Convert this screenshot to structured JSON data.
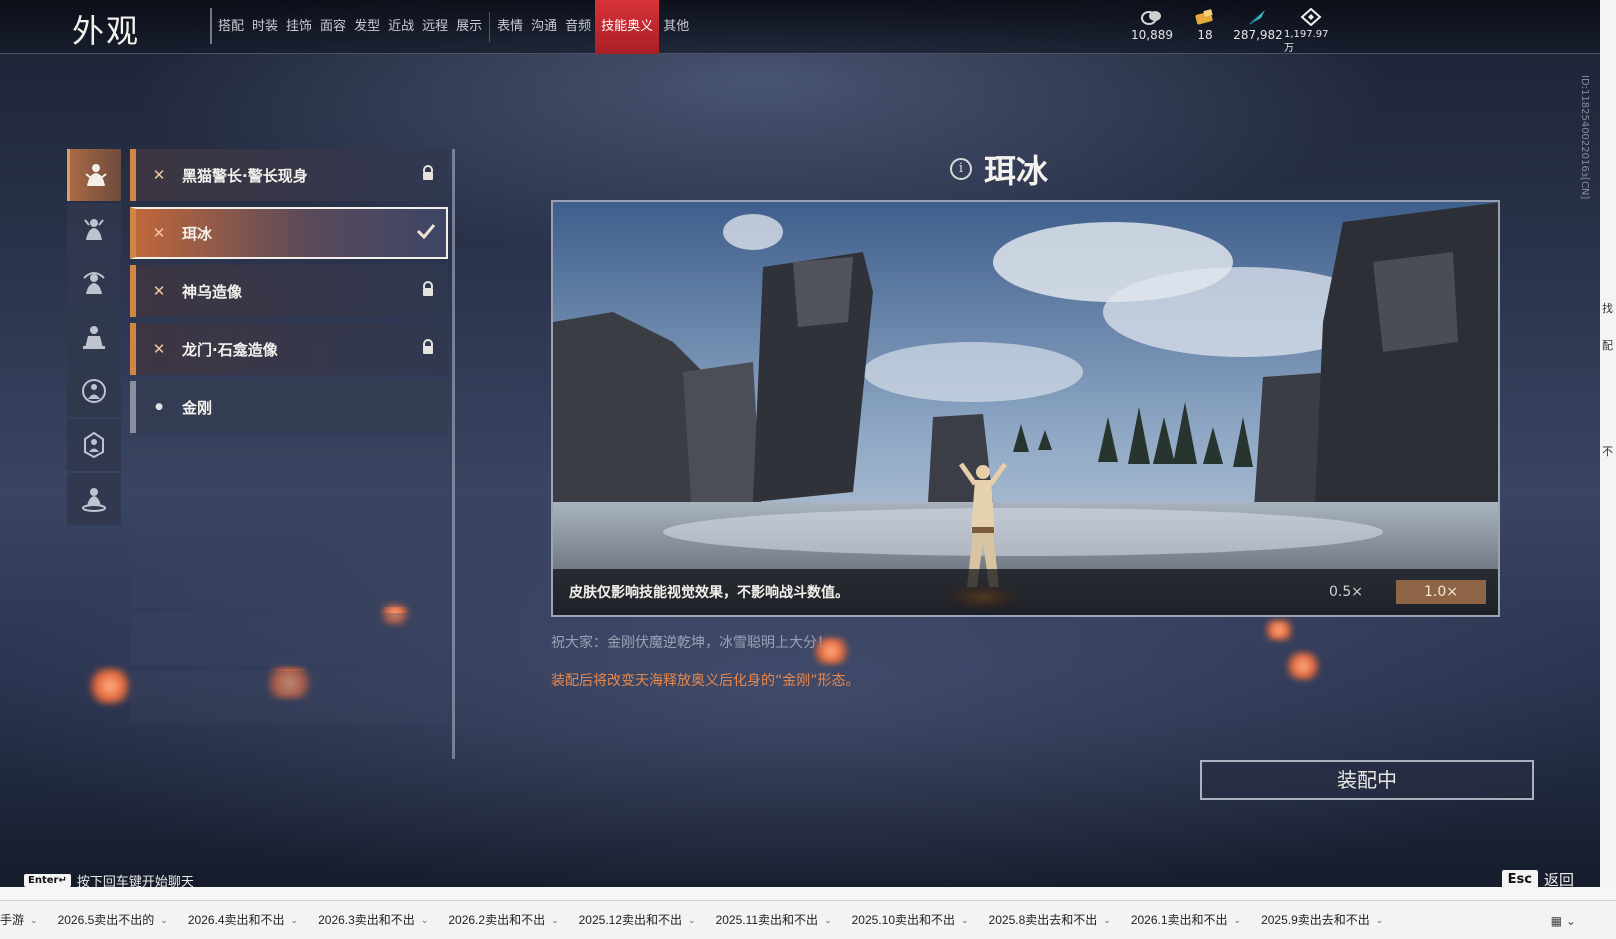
{
  "app": {
    "title": "外观"
  },
  "nav": {
    "tabs": [
      {
        "label": "搭配"
      },
      {
        "label": "时装"
      },
      {
        "label": "挂饰"
      },
      {
        "label": "面容"
      },
      {
        "label": "发型"
      },
      {
        "label": "近战"
      },
      {
        "label": "远程"
      },
      {
        "label": "展示"
      }
    ],
    "tabs2": [
      {
        "label": "表情"
      },
      {
        "label": "沟通"
      },
      {
        "label": "音频"
      },
      {
        "label": "技能奥义"
      },
      {
        "label": "其他"
      }
    ],
    "active_tab": "技能奥义"
  },
  "currencies": [
    {
      "icon": "coin-stack-icon",
      "value": "10,889"
    },
    {
      "icon": "ticket-icon",
      "value": "18"
    },
    {
      "icon": "feather-icon",
      "value": "287,982"
    },
    {
      "icon": "diamond-icon",
      "value": "1,197.97万"
    }
  ],
  "side_id": "ID:1182540022016з[CN]",
  "categories": [
    {
      "icon": "figure-icon-1"
    },
    {
      "icon": "figure-icon-2"
    },
    {
      "icon": "figure-icon-3"
    },
    {
      "icon": "figure-icon-4"
    },
    {
      "icon": "figure-icon-5"
    },
    {
      "icon": "figure-icon-6"
    },
    {
      "icon": "figure-icon-7"
    }
  ],
  "skins": [
    {
      "name": "黑猫警长·警长现身",
      "state": "locked"
    },
    {
      "name": "珥冰",
      "state": "equipped"
    },
    {
      "name": "神乌造像",
      "state": "locked"
    },
    {
      "name": "龙门·石龛造像",
      "state": "locked"
    },
    {
      "name": "金刚",
      "state": "default"
    }
  ],
  "detail": {
    "title": "珥冰",
    "caption": "皮肤仅影响技能视觉效果，不影响战斗数值。",
    "speed_slow": "0.5×",
    "speed_normal": "1.0×",
    "blessing": "祝大家：金刚伏魔逆乾坤，冰雪聪明上大分！",
    "equip_note": "装配后将改变天海释放奥义后化身的“金刚”形态。",
    "equip_button": "装配中"
  },
  "footer": {
    "chat_key": "Enter↵",
    "chat_hint": "按下回车键开始聊天",
    "esc_key": "Esc",
    "esc_label": "返回"
  },
  "right_strip": [
    "找",
    "配",
    "不"
  ],
  "sheet_tabs": [
    "手游",
    "2026.5卖出不出的",
    "2026.4卖出和不出",
    "2026.3卖出和不出",
    "2026.2卖出和不出",
    "2025.12卖出和不出",
    "2025.11卖出和不出",
    "2025.10卖出和不出",
    "2025.8卖出去和不出",
    "2026.1卖出和不出",
    "2025.9卖出去和不出"
  ],
  "colors": {
    "accent_red": "#d8323a",
    "equip_orange": "#e9874a",
    "selected_border": "#f1efe8"
  }
}
